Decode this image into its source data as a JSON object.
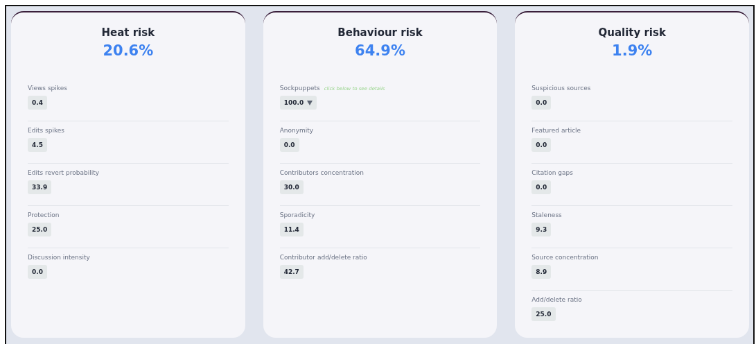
{
  "panels": [
    {
      "title": "Heat risk",
      "score": "20.6%",
      "metrics": [
        {
          "label": "Views spikes",
          "value": "0.4",
          "kind": "plain"
        },
        {
          "label": "Edits spikes",
          "value": "4.5",
          "kind": "plain"
        },
        {
          "label": "Edits revert probability",
          "value": "33.9",
          "kind": "plain"
        },
        {
          "label": "Protection",
          "value": "25.0",
          "kind": "plain"
        },
        {
          "label": "Discussion intensity",
          "value": "0.0",
          "kind": "plain"
        }
      ]
    },
    {
      "title": "Behaviour risk",
      "score": "64.9%",
      "metrics": [
        {
          "label": "Sockpuppets",
          "hint": "click below to see details",
          "value": "100.0",
          "kind": "dropdown"
        },
        {
          "label": "Anonymity",
          "value": "0.0",
          "kind": "plain"
        },
        {
          "label": "Contributors concentration",
          "value": "30.0",
          "kind": "plain"
        },
        {
          "label": "Sporadicity",
          "value": "11.4",
          "kind": "plain"
        },
        {
          "label": "Contributor add/delete ratio",
          "value": "42.7",
          "kind": "plain"
        }
      ]
    },
    {
      "title": "Quality risk",
      "score": "1.9%",
      "metrics": [
        {
          "label": "Suspicious sources",
          "value": "0.0",
          "kind": "plain"
        },
        {
          "label": "Featured article",
          "value": "0.0",
          "kind": "plain"
        },
        {
          "label": "Citation gaps",
          "value": "0.0",
          "kind": "plain"
        },
        {
          "label": "Staleness",
          "value": "9.3",
          "kind": "plain"
        },
        {
          "label": "Source concentration",
          "value": "8.9",
          "kind": "plain"
        },
        {
          "label": "Add/delete ratio",
          "value": "25.0",
          "kind": "plain"
        }
      ]
    }
  ]
}
